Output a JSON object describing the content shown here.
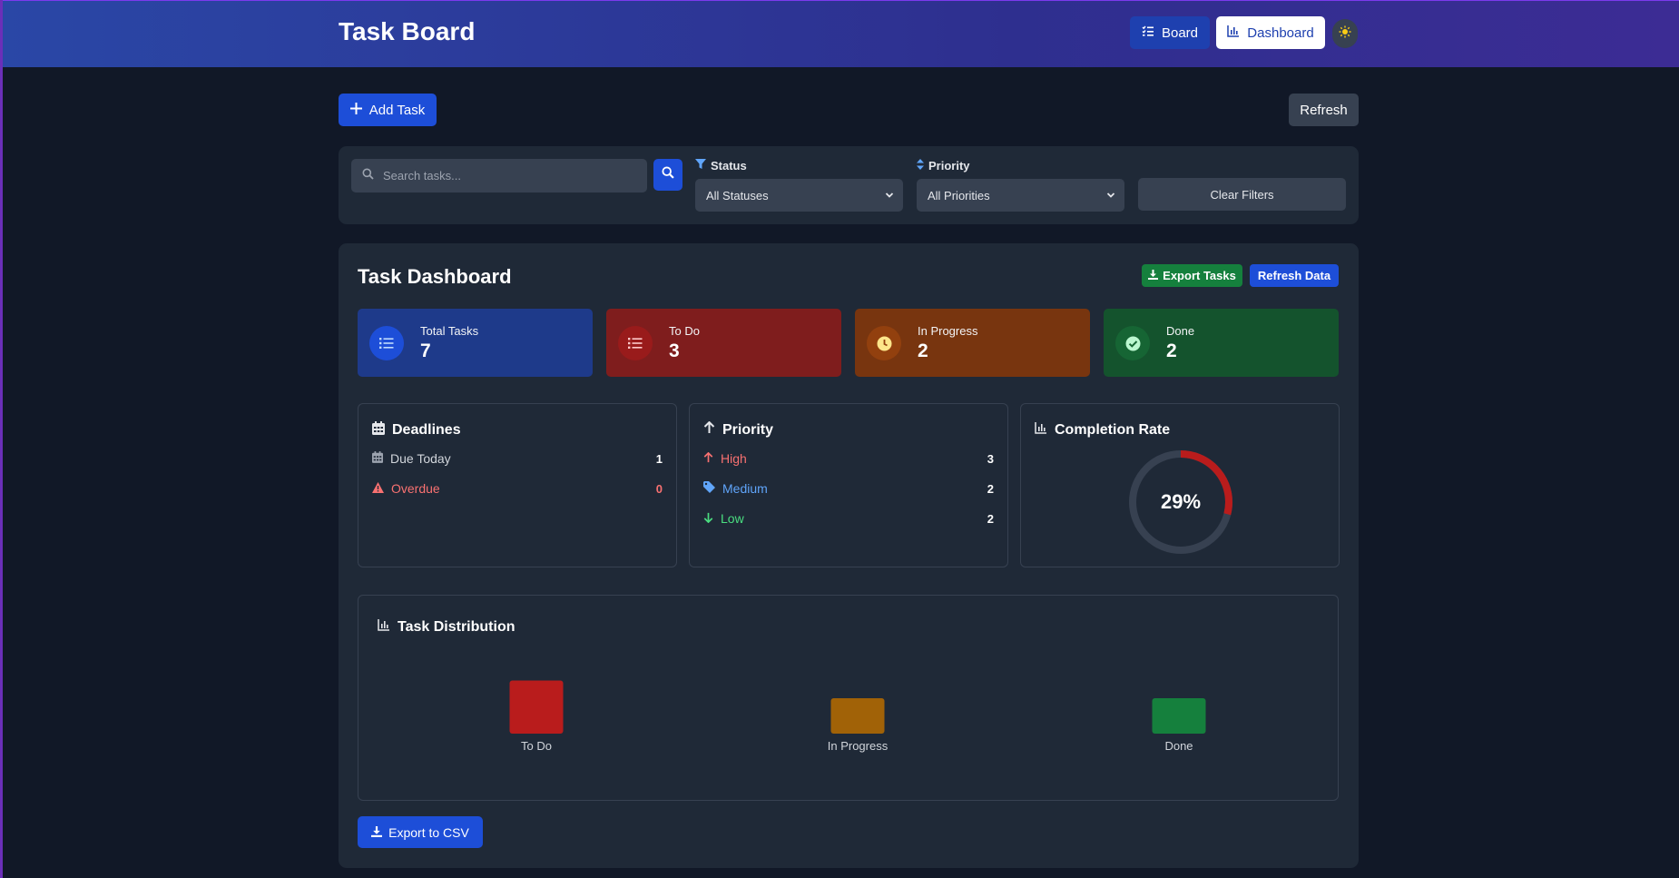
{
  "header": {
    "title": "Task Board",
    "board_label": "Board",
    "dashboard_label": "Dashboard"
  },
  "actions": {
    "add_task_label": "Add Task",
    "refresh_label": "Refresh"
  },
  "filters": {
    "search_placeholder": "Search tasks...",
    "status_label": "Status",
    "status_value": "All Statuses",
    "priority_label": "Priority",
    "priority_value": "All Priorities",
    "clear_label": "Clear Filters"
  },
  "dashboard": {
    "title": "Task Dashboard",
    "export_tasks_label": "Export Tasks",
    "refresh_data_label": "Refresh Data",
    "stats": [
      {
        "label": "Total Tasks",
        "value": "7"
      },
      {
        "label": "To Do",
        "value": "3"
      },
      {
        "label": "In Progress",
        "value": "2"
      },
      {
        "label": "Done",
        "value": "2"
      }
    ],
    "deadlines": {
      "title": "Deadlines",
      "rows": [
        {
          "label": "Due Today",
          "count": "1"
        },
        {
          "label": "Overdue",
          "count": "0"
        }
      ]
    },
    "priority": {
      "title": "Priority",
      "rows": [
        {
          "label": "High",
          "count": "3"
        },
        {
          "label": "Medium",
          "count": "2"
        },
        {
          "label": "Low",
          "count": "2"
        }
      ]
    },
    "completion": {
      "title": "Completion Rate",
      "percent_label": "29%",
      "fraction": 0.29
    },
    "distribution_title": "Task Distribution",
    "export_csv_label": "Export to CSV"
  },
  "colors": {
    "accent": "#1d4ed8",
    "todo": "#b91c1c",
    "in_progress": "#a16207",
    "done": "#15803d",
    "high": "#f87171",
    "medium": "#60a5fa",
    "low": "#4ade80"
  },
  "chart_data": {
    "type": "bar",
    "title": "Task Distribution",
    "categories": [
      "To Do",
      "In Progress",
      "Done"
    ],
    "values": [
      3,
      2,
      2
    ],
    "colors": [
      "#b91c1c",
      "#a16207",
      "#15803d"
    ],
    "xlabel": "",
    "ylabel": ""
  }
}
